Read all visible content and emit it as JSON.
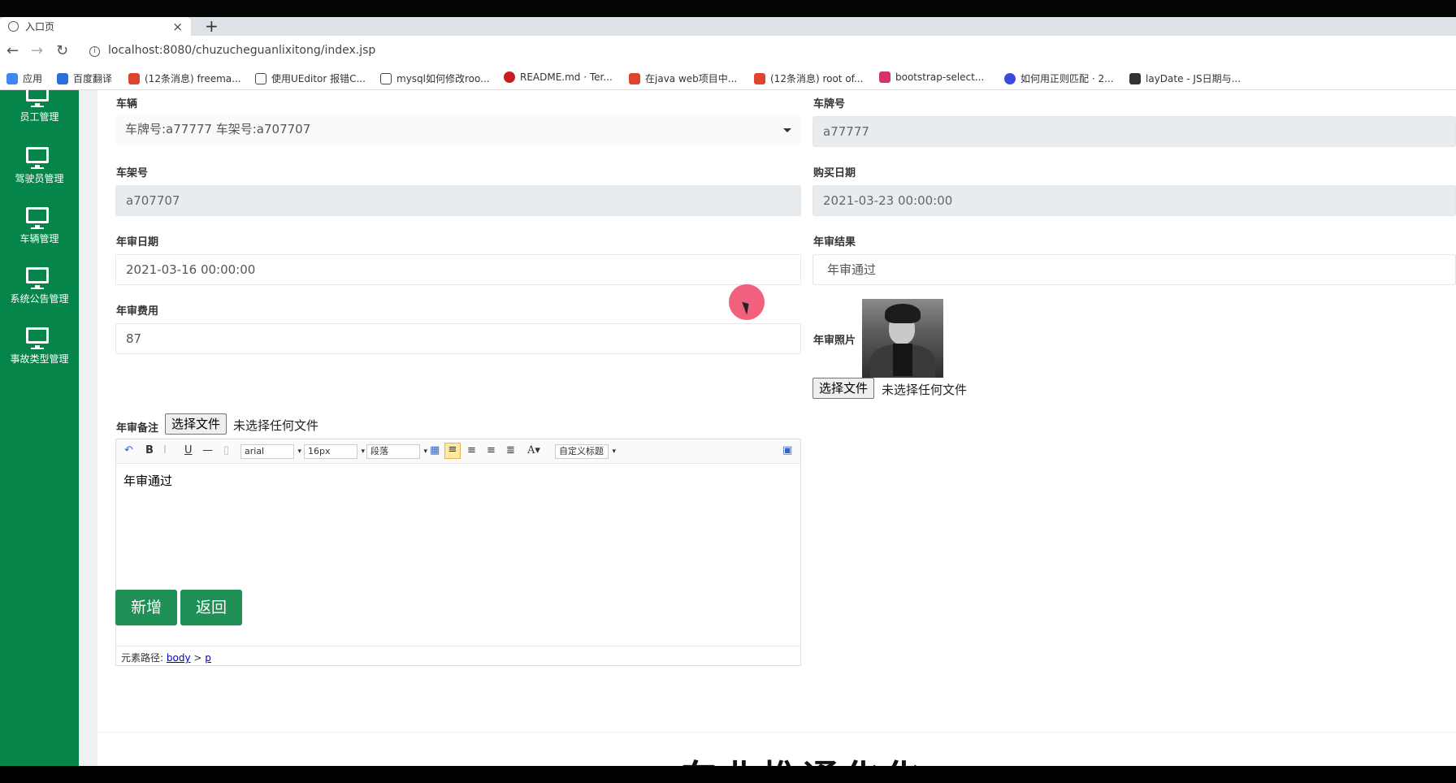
{
  "browser": {
    "tab_title": "入口页",
    "tab_close": "×",
    "new_tab": "+",
    "url": "localhost:8080/chuzucheguanlixitong/index.jsp",
    "bookmarks": [
      {
        "label": "应用",
        "color": "#4285f4"
      },
      {
        "label": "百度翻译",
        "color": "#2a6fdb"
      },
      {
        "label": "(12条消息) freema...",
        "color": "#e0442e"
      },
      {
        "label": "使用UEditor 报错C...",
        "color": "#444444"
      },
      {
        "label": "mysql如何修改roo...",
        "color": "#444444"
      },
      {
        "label": "README.md · Ter...",
        "color": "#c71d23"
      },
      {
        "label": "在java web项目中...",
        "color": "#e0442e"
      },
      {
        "label": "(12条消息) root of...",
        "color": "#e0442e"
      },
      {
        "label": "bootstrap-select...",
        "color": "#d6336c"
      },
      {
        "label": "如何用正则匹配 · 2...",
        "color": "#3b49df"
      },
      {
        "label": "layDate - JS日期与...",
        "color": "#333333"
      }
    ]
  },
  "sidebar": {
    "items": [
      {
        "label": "员工管理"
      },
      {
        "label": "驾驶员管理"
      },
      {
        "label": "车辆管理"
      },
      {
        "label": "系统公告管理"
      },
      {
        "label": "事故类型管理"
      }
    ]
  },
  "form": {
    "vehicle_label": "车辆",
    "vehicle_value": "车牌号:a77777 车架号:a707707",
    "plate_label": "车牌号",
    "plate_value": "a77777",
    "frame_label": "车架号",
    "frame_value": "a707707",
    "purchase_label": "购买日期",
    "purchase_value": "2021-03-23 00:00:00",
    "inspect_date_label": "年审日期",
    "inspect_date_value": "2021-03-16 00:00:00",
    "inspect_result_label": "年审结果",
    "inspect_result_value": "年审通过",
    "fee_label": "年审费用",
    "fee_value": "87",
    "photo_label": "年审照片",
    "choose_file": "选择文件",
    "no_file": "未选择任何文件",
    "remark_label": "年审备注"
  },
  "editor": {
    "font_family": "arial",
    "font_size": "16px",
    "paragraph": "段落",
    "custom_title": "自定义标题",
    "content": "年审通过",
    "path_label": "元素路径:",
    "path_body": "body",
    "path_sep": ">",
    "path_p": "p"
  },
  "buttons": {
    "add": "新增",
    "back": "返回"
  },
  "footer_title": "车业推通化化"
}
